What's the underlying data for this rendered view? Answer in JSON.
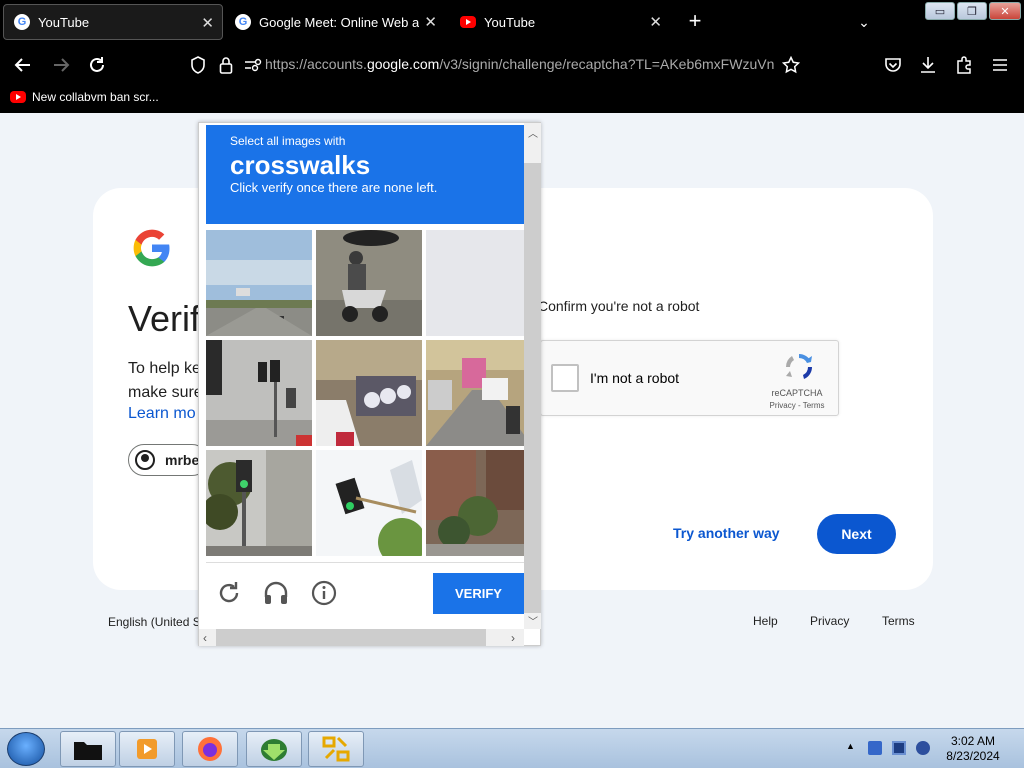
{
  "browser": {
    "tabs": [
      {
        "title": "YouTube",
        "favicon": "google-g-icon",
        "active": true
      },
      {
        "title": "Google Meet: Online Web and",
        "favicon": "google-g-icon",
        "active": false
      },
      {
        "title": "YouTube",
        "favicon": "youtube-icon",
        "active": false
      }
    ],
    "url_prefix": "https://accounts.",
    "url_host": "google.com",
    "url_path": "/v3/signin/challenge/recaptcha?TL=AKeb6mxFWzuVn",
    "bookmarks": [
      {
        "label": "New collabvm ban scr...",
        "favicon": "youtube-icon"
      }
    ],
    "window_controls": {
      "minimize": "▭",
      "maximize": "❐",
      "close": "✕"
    }
  },
  "signin_page": {
    "title": "Verif",
    "help_text_line1": "To help ke",
    "help_text_line2": "make sure",
    "learn_more": "Learn mo",
    "account_chip": "mrbe",
    "confirm_label": "Confirm you're not a robot",
    "recaptcha": {
      "checkbox_label": "I'm not a robot",
      "brand": "reCAPTCHA",
      "links": "Privacy - Terms"
    },
    "try_another_way": "Try another way",
    "next_button": "Next",
    "language": "English (United S",
    "footer_links": [
      "Help",
      "Privacy",
      "Terms"
    ]
  },
  "challenge": {
    "instruction_line1": "Select all images with",
    "keyword": "crosswalks",
    "instruction_line2": "Click verify once there are none left.",
    "verify_button": "VERIFY",
    "tool_icons": [
      "reload-icon",
      "audio-headphones-icon",
      "info-icon"
    ],
    "tiles": [
      "highway-with-sky",
      "motorcyclist-on-street",
      "blank-grey",
      "traffic-lights-against-building",
      "parked-scooters-and-car",
      "street-with-pink-bus",
      "traffic-light-near-trees",
      "traffic-light-on-pole-sky",
      "buildings-with-trees"
    ]
  },
  "taskbar": {
    "apps": [
      "folder-icon",
      "media-player-icon",
      "firefox-icon",
      "download-manager-icon",
      "file-manager-icon"
    ],
    "time": "3:02 AM",
    "date": "8/23/2024"
  },
  "colors": {
    "accent_blue": "#1a73e8",
    "google_button": "#0b57d0",
    "page_bg": "#f0f4f9"
  }
}
